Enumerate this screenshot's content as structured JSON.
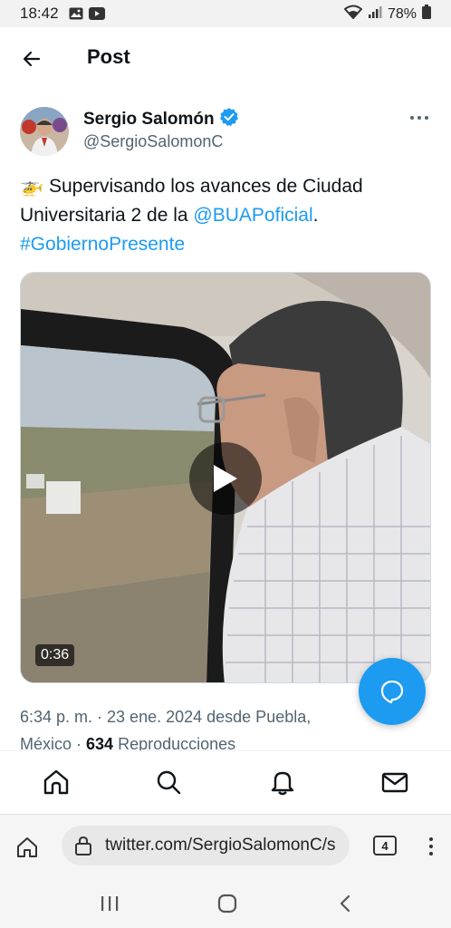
{
  "status_bar": {
    "time": "18:42",
    "battery": "78%",
    "left_icons": [
      "gallery-icon",
      "youtube-icon"
    ],
    "right_icons": [
      "wifi-icon",
      "signal-icon",
      "battery-icon"
    ]
  },
  "header": {
    "title": "Post"
  },
  "post": {
    "author_name": "Sergio Salomón",
    "author_handle": "@SergioSalomonC",
    "verified": true,
    "text_emoji": "🚁",
    "text_main": " Supervisando los avances de Ciudad Universitaria 2 de la ",
    "mention": "@BUAPoficial",
    "text_end": ".",
    "hashtag": "#GobiernoPresente",
    "video_duration": "0:36",
    "meta_time": "6:34 p. m. · 23 ene. 2024 desde Puebla, México · ",
    "views_count": "634",
    "views_label": " Reproducciones"
  },
  "bottom_nav": {
    "items": [
      "home-icon",
      "search-icon",
      "notifications-icon",
      "messages-icon"
    ]
  },
  "browser": {
    "url": "twitter.com/SergioSalomonC/s",
    "tab_count": "4"
  },
  "colors": {
    "accent": "#1d9bf0",
    "text_primary": "#0f1419",
    "text_secondary": "#536471"
  }
}
